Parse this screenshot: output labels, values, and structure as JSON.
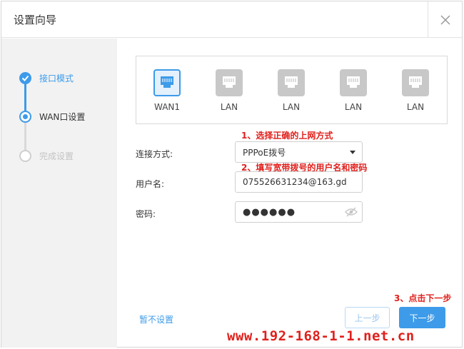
{
  "dialog": {
    "title": "设置向导"
  },
  "steps": [
    {
      "label": "接口模式",
      "state": "done"
    },
    {
      "label": "WAN口设置",
      "state": "active"
    },
    {
      "label": "完成设置",
      "state": "pending"
    }
  ],
  "ports": [
    {
      "label": "WAN1",
      "selected": true,
      "icon": "ethernet-port-icon"
    },
    {
      "label": "LAN",
      "selected": false,
      "icon": "ethernet-port-icon"
    },
    {
      "label": "LAN",
      "selected": false,
      "icon": "ethernet-port-icon"
    },
    {
      "label": "LAN",
      "selected": false,
      "icon": "ethernet-port-icon"
    },
    {
      "label": "LAN",
      "selected": false,
      "icon": "ethernet-port-icon"
    }
  ],
  "annotations": {
    "a1": "1、选择正确的上网方式",
    "a2": "2、填写宽带拨号的用户名和密码",
    "a3": "3、点击下一步"
  },
  "form": {
    "connection_label": "连接方式:",
    "connection_value": "PPPoE拨号",
    "username_label": "用户名:",
    "username_value": "075526631234@163.gd",
    "password_label": "密码:",
    "password_masked": "●●●●●●"
  },
  "buttons": {
    "skip": "暂不设置",
    "prev": "上一步",
    "next": "下一步"
  },
  "watermark": "www.192-168-1-1.net.cn",
  "colors": {
    "accent": "#3d9be9",
    "annotation": "#e0201c",
    "sidebar_bg": "#f2f2f2"
  }
}
